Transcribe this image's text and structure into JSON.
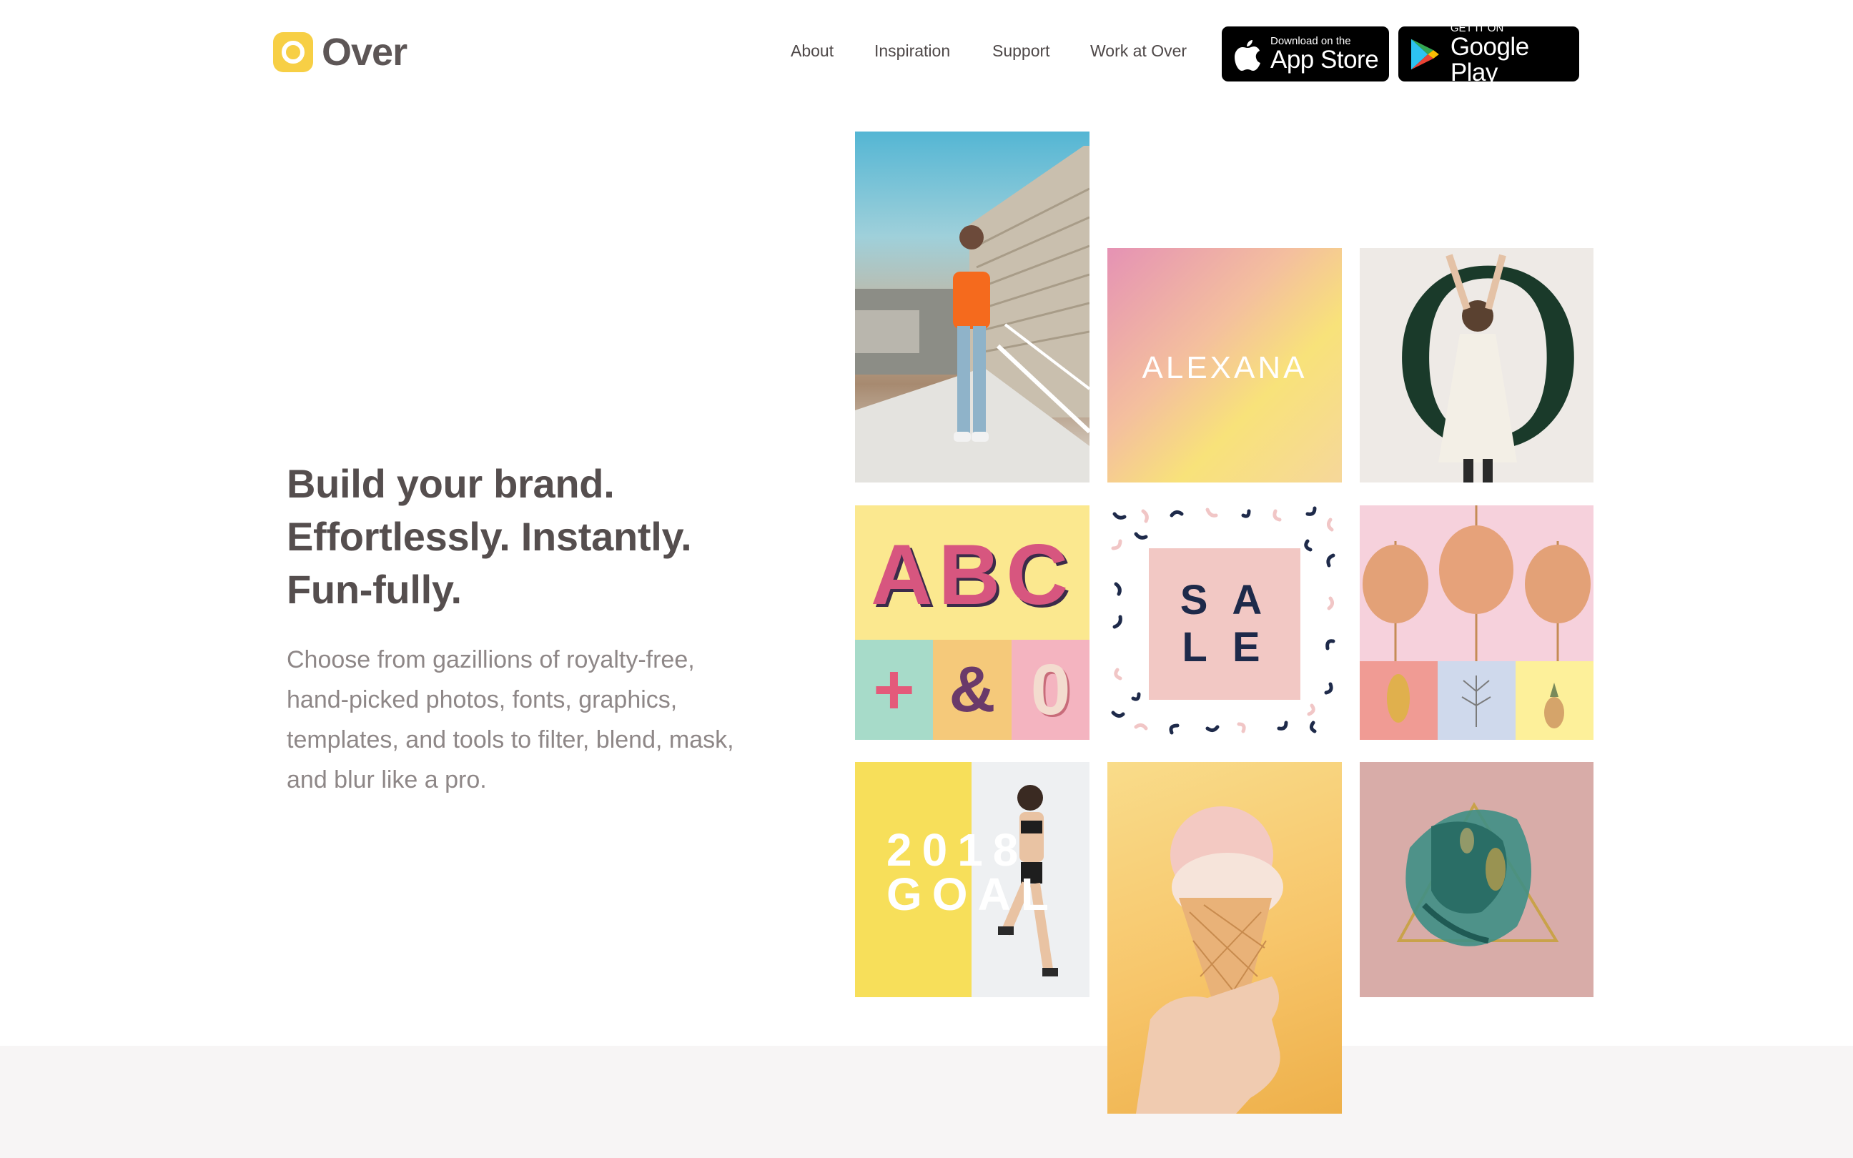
{
  "brand": {
    "name": "Over"
  },
  "nav": {
    "items": [
      "About",
      "Inspiration",
      "Support",
      "Work at Over"
    ]
  },
  "stores": {
    "apple": {
      "small": "Download on the",
      "big": "App Store"
    },
    "google": {
      "small": "GET IT ON",
      "big": "Google Play"
    }
  },
  "hero": {
    "headline": [
      "Build your brand.",
      "Effortlessly. Instantly.",
      "Fun-fully."
    ],
    "description": [
      "Choose from gazillions of royalty-free,",
      "hand-picked photos, fonts, graphics,",
      "templates, and tools to filter, blend, mask,",
      "and blur like a pro."
    ]
  },
  "tiles": {
    "alexana": "ALEXANA",
    "o_letter": "O",
    "abc": "ABC",
    "plus": "+",
    "amp": "&",
    "zero": "0",
    "sale": [
      "S A",
      "L E"
    ],
    "goal": [
      "2018",
      "GOAL"
    ]
  },
  "colors": {
    "accent": "#f7cf45",
    "text": "#554e4e",
    "muted": "#8e8787"
  }
}
